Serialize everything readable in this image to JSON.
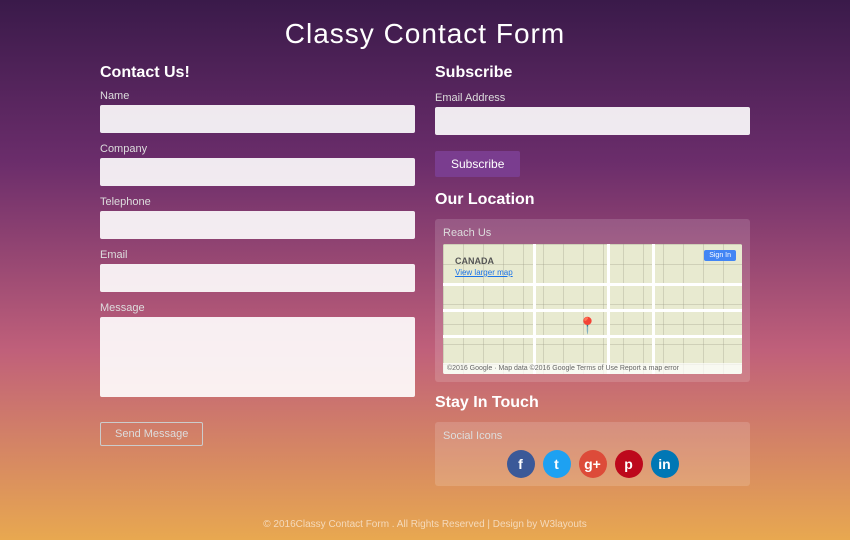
{
  "page": {
    "title": "Classy Contact Form"
  },
  "contact_form": {
    "section_title": "Contact Us!",
    "name_label": "Name",
    "name_placeholder": "",
    "company_label": "Company",
    "company_placeholder": "",
    "telephone_label": "Telephone",
    "telephone_placeholder": "",
    "email_label": "Email",
    "email_placeholder": "",
    "message_label": "Message",
    "message_placeholder": "",
    "send_button": "Send Message"
  },
  "subscribe": {
    "section_title": "Subscribe",
    "email_label": "Email Address",
    "email_placeholder": "",
    "button_label": "Subscribe"
  },
  "location": {
    "section_title": "Our Location",
    "box_title": "Reach Us",
    "map_label": "CANADA",
    "map_link": "View larger map",
    "map_sign_in": "Sign In",
    "map_bottom": "©2016 Google · Map data ©2016 Google  Terms of Use  Report a map error"
  },
  "social": {
    "section_title": "Stay In Touch",
    "box_title": "Social Icons",
    "icons": [
      {
        "name": "facebook",
        "symbol": "f",
        "class": "facebook"
      },
      {
        "name": "twitter",
        "symbol": "t",
        "class": "twitter"
      },
      {
        "name": "google-plus",
        "symbol": "g+",
        "class": "google"
      },
      {
        "name": "pinterest",
        "symbol": "p",
        "class": "pinterest"
      },
      {
        "name": "linkedin",
        "symbol": "in",
        "class": "linkedin"
      }
    ]
  },
  "footer": {
    "text": "© 2016Classy Contact Form . All Rights Reserved | Design by W3layouts"
  }
}
